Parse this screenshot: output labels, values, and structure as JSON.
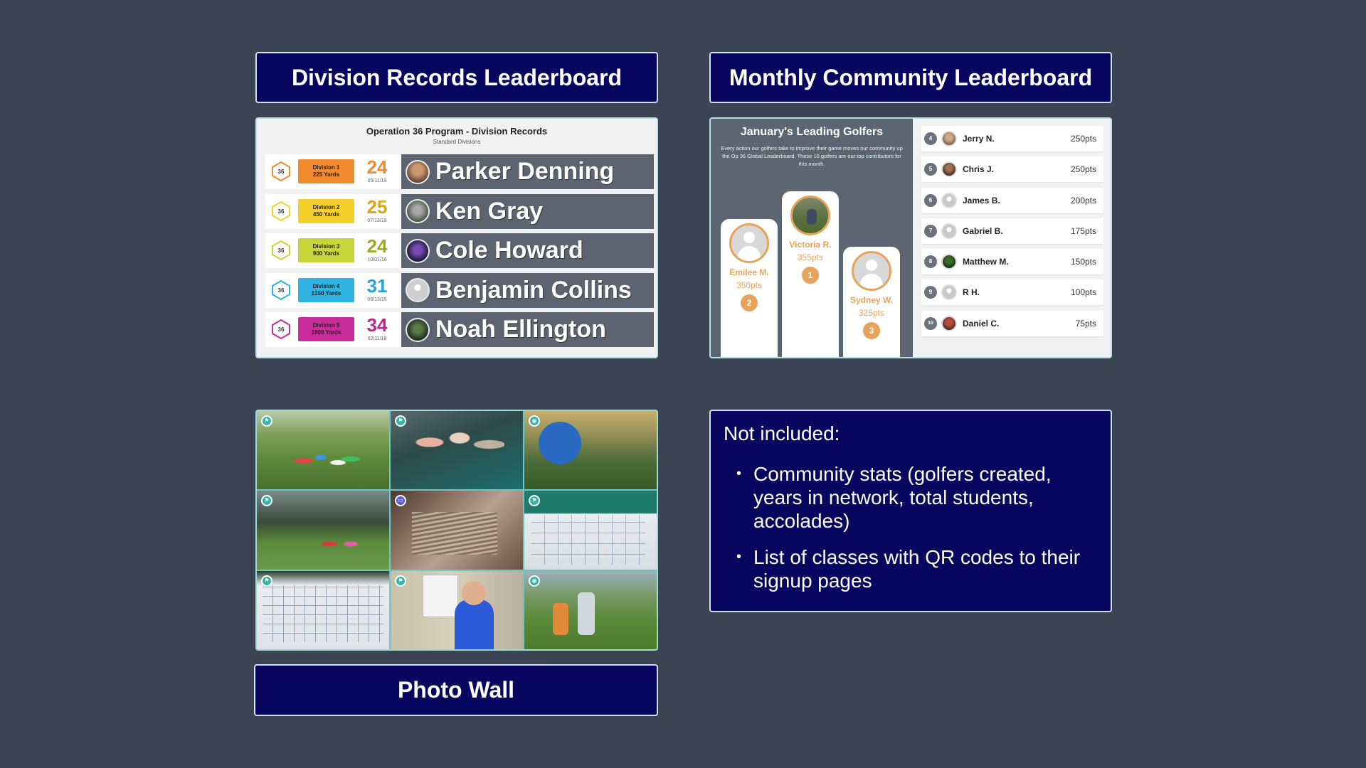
{
  "titles": {
    "division": "Division Records Leaderboard",
    "monthly": "Monthly Community Leaderboard",
    "photo_wall": "Photo Wall"
  },
  "division_records": {
    "title": "Operation 36 Program - Division Records",
    "subtitle": "Standard Divisions",
    "hex_label": "36",
    "rows": [
      {
        "division": "Division 1",
        "yards": "225 Yards",
        "score": "24",
        "date": "05/11/19",
        "name": "Parker Denning",
        "color": "#f08a2c",
        "text_color": "#f08a2c"
      },
      {
        "division": "Division 2",
        "yards": "450 Yards",
        "score": "25",
        "date": "07/13/19",
        "name": "Ken Gray",
        "color": "#f5cf2a",
        "text_color": "#d9a818"
      },
      {
        "division": "Division 3",
        "yards": "900 Yards",
        "score": "24",
        "date": "10/01/16",
        "name": "Cole Howard",
        "color": "#c7d43a",
        "text_color": "#9aab22"
      },
      {
        "division": "Division 4",
        "yards": "1350 Yards",
        "score": "31",
        "date": "09/13/15",
        "name": "Benjamin Collins",
        "color": "#2fb3e3",
        "text_color": "#2aa3d8"
      },
      {
        "division": "Division 5",
        "yards": "1800 Yards",
        "score": "34",
        "date": "02/11/18",
        "name": "Noah Ellington",
        "color": "#c92c9a",
        "text_color": "#b8278f"
      }
    ]
  },
  "monthly": {
    "title": "January's Leading Golfers",
    "description": "Every action our golfers take to improve their game moves our community up the Op 36 Global Leaderboard. These 10 golfers are our top contributors for this month.",
    "podium": [
      {
        "name": "Emilee M.",
        "pts": "350pts",
        "rank": "2"
      },
      {
        "name": "Victoria R.",
        "pts": "355pts",
        "rank": "1"
      },
      {
        "name": "Sydney W.",
        "pts": "325pts",
        "rank": "3"
      }
    ],
    "list": [
      {
        "rank": "4",
        "name": "Jerry N.",
        "pts": "250pts"
      },
      {
        "rank": "5",
        "name": "Chris J.",
        "pts": "250pts"
      },
      {
        "rank": "6",
        "name": "James B.",
        "pts": "200pts"
      },
      {
        "rank": "7",
        "name": "Gabriel B.",
        "pts": "175pts"
      },
      {
        "rank": "8",
        "name": "Matthew M.",
        "pts": "150pts"
      },
      {
        "rank": "9",
        "name": "R H.",
        "pts": "100pts"
      },
      {
        "rank": "10",
        "name": "Daniel C.",
        "pts": "75pts"
      }
    ]
  },
  "not_included": {
    "heading": "Not included:",
    "items": [
      "Community stats (golfers created, years in network, total students, accolades)",
      "List of classes with QR codes to their signup pages"
    ],
    "bullet": "•"
  },
  "colors": {
    "background": "#3a4452",
    "title_box": "#07075f",
    "podium_accent": "#e8a35a",
    "photo_border": "#6bc7c3"
  }
}
